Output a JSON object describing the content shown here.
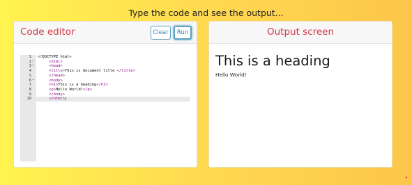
{
  "page": {
    "heading": "Type the code and see the output..."
  },
  "editor_card": {
    "title": "Code editor",
    "clear_label": "Clear",
    "run_label": "Run",
    "lines": [
      {
        "num": "1",
        "fold": "",
        "indent": "",
        "parts": [
          [
            "t",
            "<!DOCTYPE html>"
          ]
        ]
      },
      {
        "num": "2",
        "fold": "▾",
        "indent": "     ",
        "parts": [
          [
            "k",
            "<html>"
          ]
        ]
      },
      {
        "num": "3",
        "fold": "▾",
        "indent": "     ",
        "parts": [
          [
            "k",
            "<head>"
          ]
        ]
      },
      {
        "num": "4",
        "fold": "",
        "indent": "     ",
        "parts": [
          [
            "k",
            "<title>"
          ],
          [
            "t",
            "This is document title "
          ],
          [
            "k",
            "</title>"
          ]
        ]
      },
      {
        "num": "5",
        "fold": "",
        "indent": "     ",
        "parts": [
          [
            "k",
            "</head>"
          ]
        ]
      },
      {
        "num": "6",
        "fold": "▾",
        "indent": "     ",
        "parts": [
          [
            "k",
            "<body>"
          ]
        ]
      },
      {
        "num": "7",
        "fold": "",
        "indent": "     ",
        "parts": [
          [
            "k",
            "<h1>"
          ],
          [
            "t",
            "This is a heading"
          ],
          [
            "k",
            "</h1>"
          ]
        ]
      },
      {
        "num": "8",
        "fold": "",
        "indent": "     ",
        "parts": [
          [
            "k",
            "<p>"
          ],
          [
            "t",
            "Hello World!"
          ],
          [
            "k",
            "</p>"
          ]
        ]
      },
      {
        "num": "9",
        "fold": "",
        "indent": "     ",
        "parts": [
          [
            "k",
            "</body>"
          ]
        ]
      },
      {
        "num": "10",
        "fold": "",
        "indent": "     ",
        "parts": [
          [
            "k",
            "</html>"
          ],
          [
            "t",
            "|"
          ]
        ]
      }
    ],
    "active_line": 10
  },
  "output_card": {
    "title": "Output screen",
    "h1": "This is a heading",
    "p": "Hello World!"
  },
  "colors": {
    "title_red": "#d23a46",
    "tag_purple": "#8b0a84",
    "button_blue": "#337ab7"
  }
}
